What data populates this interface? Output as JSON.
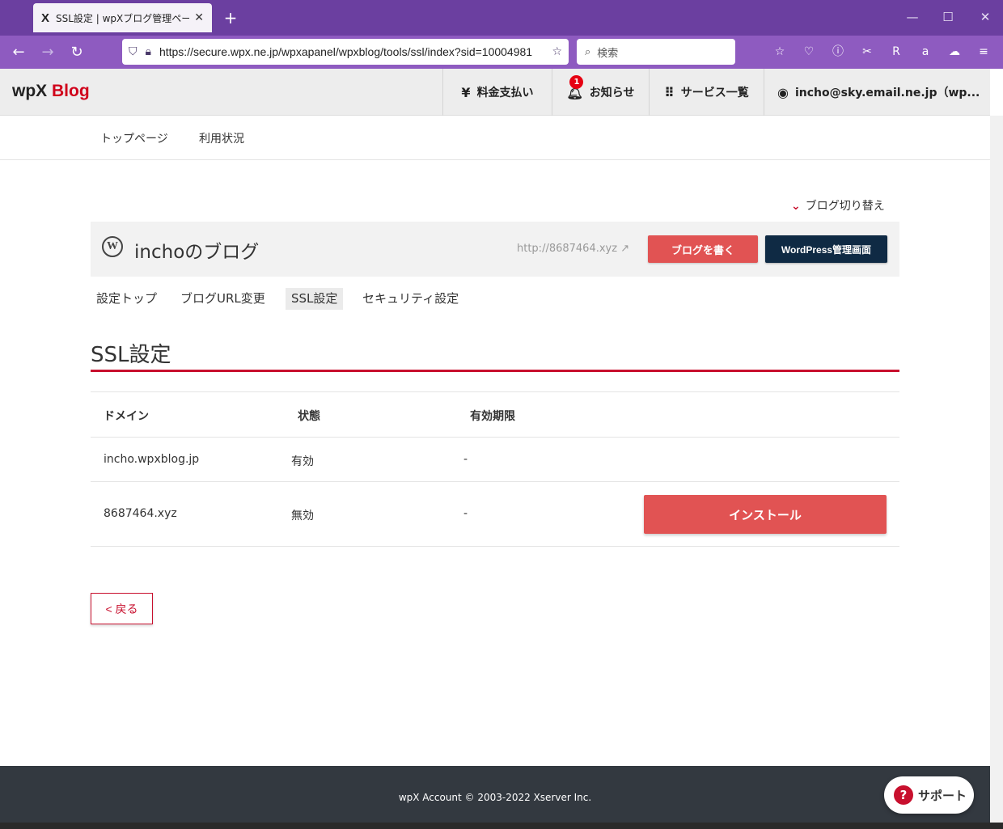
{
  "browser": {
    "tab_title": "SSL設定 | wpXブログ管理ページ",
    "tab_favicon": "X",
    "url": "https://secure.wpx.ne.jp/wpxapanel/wpxblog/tools/ssl/index?sid=10004981",
    "search_placeholder": "検索"
  },
  "header": {
    "logo_wpx": "wpX",
    "logo_blog": "Blog",
    "payment": "料金支払い",
    "notifications": "お知らせ",
    "notification_count": "1",
    "services": "サービス一覧",
    "account": "incho@sky.email.ne.jp（wp..."
  },
  "subnav": {
    "top": "トップページ",
    "usage": "利用状況"
  },
  "blog_switch": "ブログ切り替え",
  "blog": {
    "name": "inchoのブログ",
    "url": "http://8687464.xyz",
    "write_button": "ブログを書く",
    "wp_button": "WordPress管理画面"
  },
  "tabs": {
    "settings_top": "設定トップ",
    "url_change": "ブログURL変更",
    "ssl": "SSL設定",
    "security": "セキュリティ設定"
  },
  "page_title": "SSL設定",
  "table": {
    "headers": {
      "domain": "ドメイン",
      "status": "状態",
      "expiry": "有効期限"
    },
    "rows": [
      {
        "domain": "incho.wpxblog.jp",
        "status": "有効",
        "expiry": "-"
      },
      {
        "domain": "8687464.xyz",
        "status": "無効",
        "expiry": "-",
        "action": "インストール"
      }
    ]
  },
  "back_button": "< 戻る",
  "footer": "wpX Account © 2003-2022 Xserver Inc.",
  "support": "サポート",
  "colors": {
    "accent_red": "#c8102e",
    "button_red": "#e15353",
    "navy": "#0f2a44",
    "browser_purple": "#8e5bc0"
  }
}
